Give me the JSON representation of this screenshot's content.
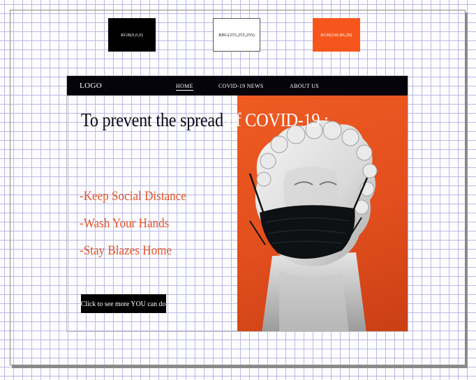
{
  "swatches": [
    {
      "label": "RGB(0,0,0)",
      "color": "#000000"
    },
    {
      "label": "RBG(255,255,255)",
      "color": "#ffffff"
    },
    {
      "label": "RGB(246,86,28)",
      "color": "#f6561c"
    }
  ],
  "site": {
    "logo": "LOGO",
    "nav": [
      "HOME",
      "COVID-19 NEWS",
      "ABOUT US"
    ],
    "headline_dark": "To prevent the spread ",
    "headline_light": "of COVID-19 :",
    "tips": [
      "-Keep Social Distance",
      "-Wash Your Hands",
      "-Stay Blazes Home"
    ],
    "cta": "Click to see more YOU can do"
  },
  "colors": {
    "black": "#000000",
    "white": "#ffffff",
    "accent": "#f6561c"
  },
  "icons": {
    "hero_image": "masked-statue-bust"
  }
}
